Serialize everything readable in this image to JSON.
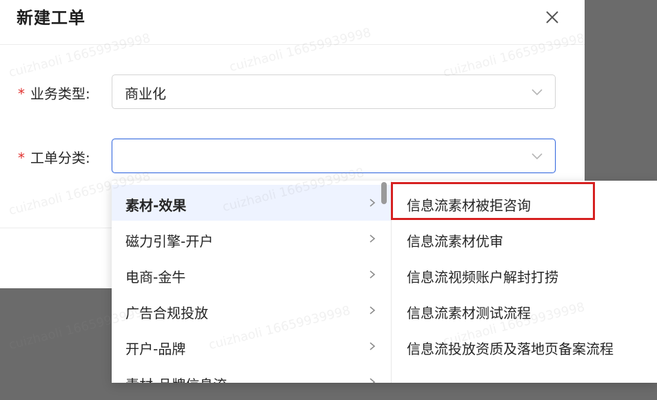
{
  "dialog": {
    "title": "新建工单",
    "close_icon": "close-icon"
  },
  "form": {
    "business_type": {
      "required_mark": "*",
      "label": "业务类型:",
      "value": "商业化"
    },
    "ticket_category": {
      "required_mark": "*",
      "label": "工单分类:",
      "value": ""
    }
  },
  "cascader": {
    "level1": [
      {
        "label": "素材-效果",
        "active": true
      },
      {
        "label": "磁力引擎-开户"
      },
      {
        "label": "电商-金牛"
      },
      {
        "label": "广告合规投放"
      },
      {
        "label": "开户-品牌"
      },
      {
        "label": "素材-品牌信息流"
      }
    ],
    "level2": [
      {
        "label": "信息流素材被拒咨询",
        "highlighted": true
      },
      {
        "label": "信息流素材优审"
      },
      {
        "label": "信息流视频账户解封打捞"
      },
      {
        "label": "信息流素材测试流程"
      },
      {
        "label": "信息流投放资质及落地页备案流程"
      }
    ]
  },
  "watermark": "cuizhaoli 16659939998",
  "colors": {
    "required": "#e0312f",
    "focus_border": "#3b6ee0",
    "active_bg": "#eef3ff",
    "annotation": "#d62020",
    "overlay": "#6b6b6b"
  }
}
